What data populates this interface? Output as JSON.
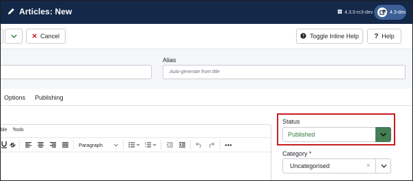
{
  "header": {
    "title": "Articles: New",
    "version": "4.3.0-rc3-dev",
    "site_badge": "4.3-dev",
    "colors": {
      "bg": "#142849",
      "badge": "#3c5f95"
    }
  },
  "toolbar": {
    "cancel_label": "Cancel",
    "toggle_help_label": "Toggle Inline Help",
    "help_label": "Help"
  },
  "form": {
    "alias_label": "Alias",
    "alias_placeholder": "Auto-generate from title"
  },
  "tabs": [
    {
      "label": "Options"
    },
    {
      "label": "Publishing"
    }
  ],
  "editor": {
    "menu": [
      "ble",
      "Tools"
    ],
    "format_select": "Paragraph",
    "icons": [
      "underline-icon",
      "strikethrough-icon",
      "align-left-icon",
      "align-center-icon",
      "align-right-icon",
      "align-justify-icon",
      "bullet-list-icon",
      "numbered-list-icon",
      "outdent-icon",
      "indent-icon",
      "undo-icon",
      "redo-icon",
      "more-icon"
    ]
  },
  "sidebar": {
    "status_label": "Status",
    "status_value": "Published",
    "category_label": "Category *",
    "category_value": "Uncategorised",
    "colors": {
      "status_text": "#2e7a3a",
      "status_dropdown": "#457d54",
      "highlight": "#c8191f"
    }
  }
}
